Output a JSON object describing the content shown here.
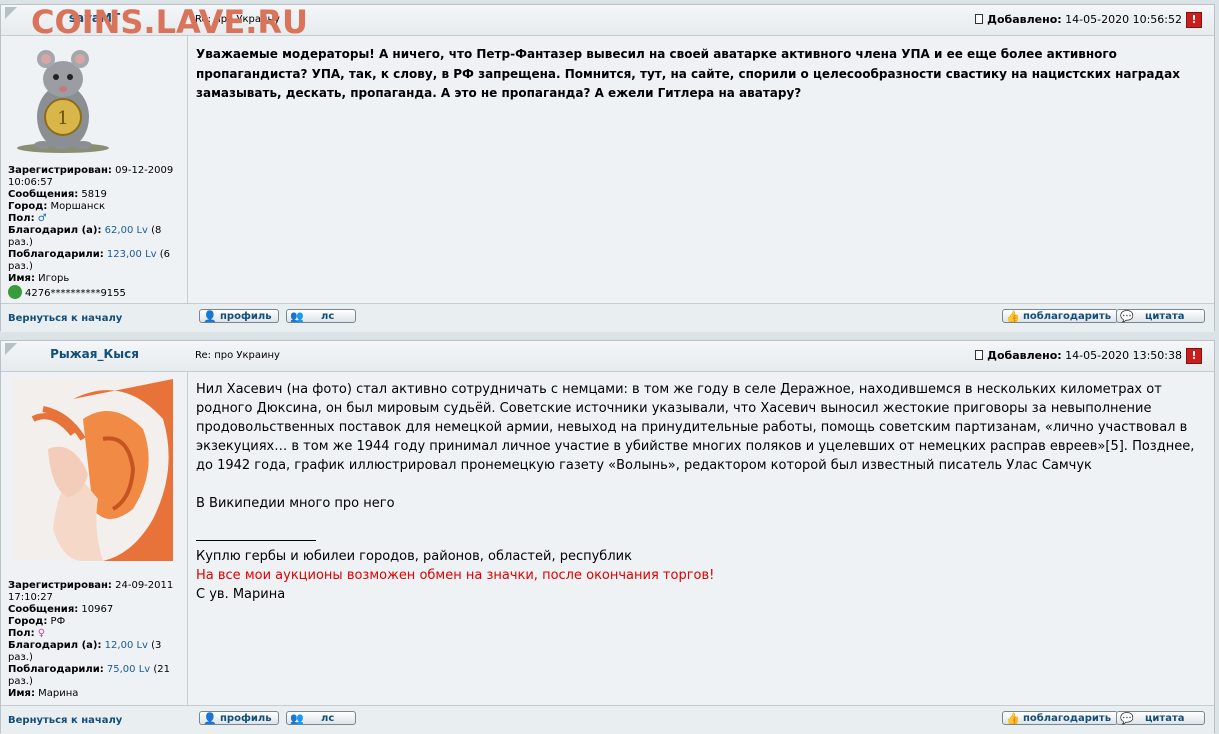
{
  "watermark": "COINS.LAVE.RU",
  "posts": [
    {
      "author": "savaMT",
      "subject": "Re: про Украину",
      "added_label": "Добавлено:",
      "added_date": "14-05-2020 10:56:52",
      "report": "!",
      "body": "Уважаемые модераторы! А ничего, что Петр-Фантазер вывесил на своей аватарке активного члена УПА и ее еще более активного пропагандиста? УПА, так, к слову, в РФ запрещена. Помнится, тут, на сайте, спорили о целесообразности свастику на нацистских наградах замазывать, дескать, пропаганда. А это не пропаганда? А ежели Гитлера на аватару?",
      "registered_label": "Зарегистрирован:",
      "registered": "09-12-2009 10:06:57",
      "messages_label": "Сообщения:",
      "messages": "5819",
      "city_label": "Город:",
      "city": "Моршанск",
      "gender_label": "Пол:",
      "gender_icon": "male-icon",
      "thanked_label": "Благодарил (а):",
      "thanked_value": "62,00 Lv",
      "thanked_times": "(8 раз.)",
      "got_thanks_label": "Поблагодарили:",
      "got_thanks_value": "123,00 Lv",
      "got_thanks_times": "(6 раз.)",
      "name_label": "Имя:",
      "name": "Игорь",
      "card": "4276**********9155"
    },
    {
      "author": "Рыжая_Кыся",
      "subject": "Re: про Украину",
      "added_label": "Добавлено:",
      "added_date": "14-05-2020 13:50:38",
      "report": "!",
      "body_p1": "Нил Хасевич (на фото) стал активно сотрудничать с немцами: в том же году в селе Деражное, находившемся в нескольких километрах от родного Дюксина, он был мировым судьёй. Советские источники указывали, что Хасевич выносил жестокие приговоры за невыполнение продовольственных поставок для немецкой армии, невыход на принудительные работы, помощь советским партизанам, «лично участвовал в экзекуциях… в том же 1944 году принимал личное участие в убийстве многих поляков и уцелевших от немецких расправ евреев»[5]. Позднее, до 1942 года, график иллюстрировал пронемецкую газету «Волынь», редактором которой был известный писатель Улас Самчук",
      "body_p2": "В Википедии много про него",
      "sig1": "Куплю гербы и юбилеи городов, районов, областей, республик",
      "sig2": "На все мои аукционы возможен обмен на значки, после окончания торгов!",
      "sig3": "С ув. Марина",
      "registered_label": "Зарегистрирован:",
      "registered": "24-09-2011 17:10:27",
      "messages_label": "Сообщения:",
      "messages": "10967",
      "city_label": "Город:",
      "city": "РФ",
      "gender_label": "Пол:",
      "gender_icon": "female-icon",
      "thanked_label": "Благодарил (а):",
      "thanked_value": "12,00 Lv",
      "thanked_times": "(3 раз.)",
      "got_thanks_label": "Поблагодарили:",
      "got_thanks_value": "75,00 Lv",
      "got_thanks_times": "(21 раз.)",
      "name_label": "Имя:",
      "name": "Марина"
    }
  ],
  "footer": {
    "back": "Вернуться к началу",
    "profile": "профиль",
    "pm": "лс",
    "thank": "поблагодарить",
    "quote": "цитата"
  }
}
